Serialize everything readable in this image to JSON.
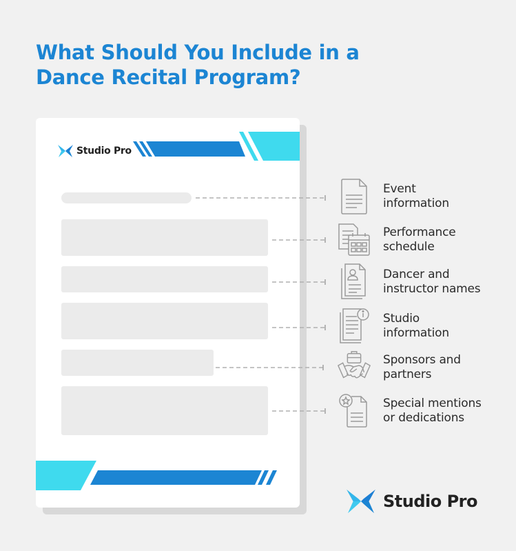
{
  "title": {
    "line1": "What Should You Include in a",
    "line2": "Dance Recital Program?"
  },
  "brand": {
    "name": "Studio Pro",
    "icon": "studio-pro-logo-icon"
  },
  "colors": {
    "title": "#1c85d3",
    "accent_blue": "#1c85d3",
    "accent_cyan": "#3fdaee",
    "placeholder": "#ebebeb",
    "background": "#f1f1f1"
  },
  "items": [
    {
      "label_line1": "Event",
      "label_line2": "information",
      "icon": "document-icon"
    },
    {
      "label_line1": "Performance",
      "label_line2": "schedule",
      "icon": "calendar-document-icon"
    },
    {
      "label_line1": "Dancer and",
      "label_line2": "instructor names",
      "icon": "profile-document-icon"
    },
    {
      "label_line1": "Studio",
      "label_line2": "information",
      "icon": "info-document-icon"
    },
    {
      "label_line1": "Sponsors and",
      "label_line2": "partners",
      "icon": "handshake-icon"
    },
    {
      "label_line1": "Special mentions",
      "label_line2": "or dedications",
      "icon": "star-document-icon"
    }
  ]
}
